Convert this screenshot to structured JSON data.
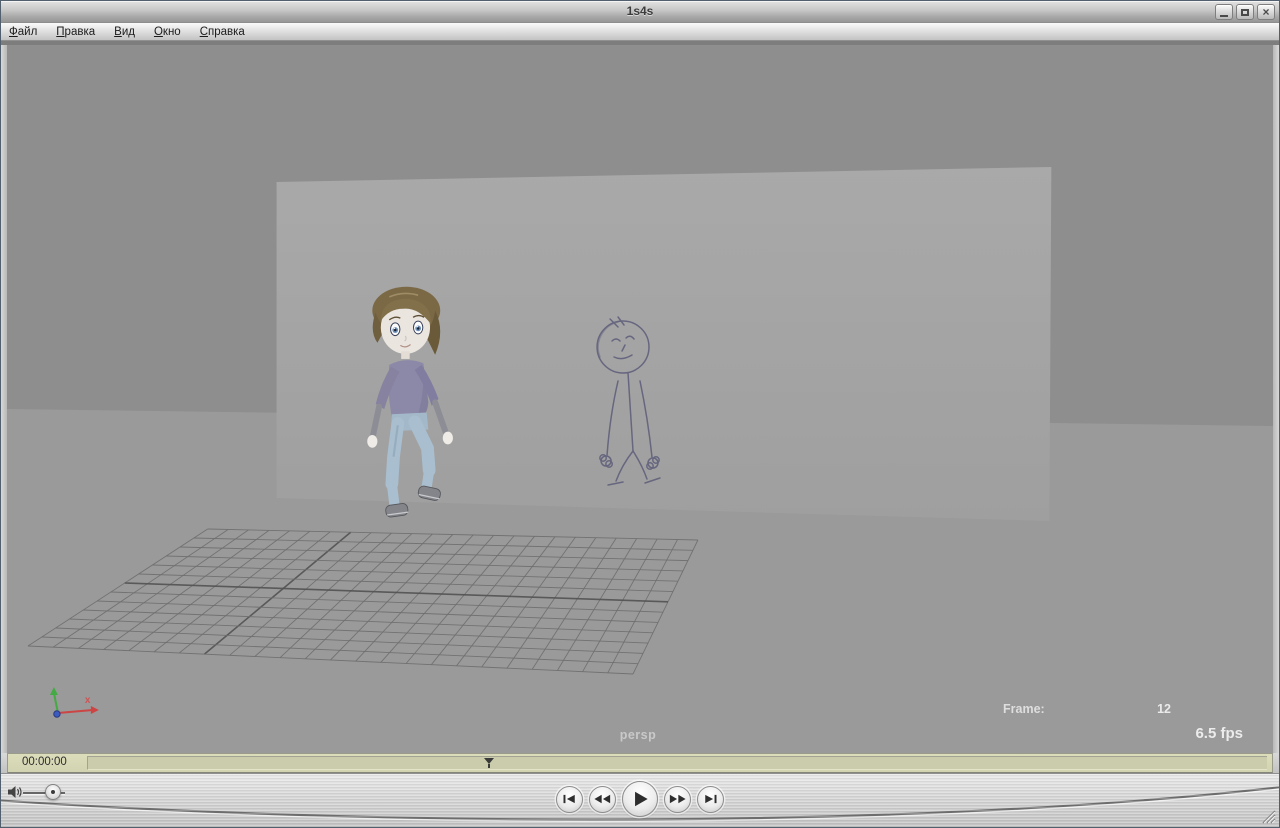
{
  "window": {
    "title": "1s4s",
    "controls": {
      "minimize": "minimize",
      "maximize": "maximize",
      "close": "close"
    }
  },
  "menu": {
    "items": [
      {
        "label": "Файл"
      },
      {
        "label": "Правка"
      },
      {
        "label": "Вид"
      },
      {
        "label": "Окно"
      },
      {
        "label": "Справка"
      }
    ]
  },
  "viewport": {
    "camera_label": "persp",
    "frame_label": "Frame:",
    "frame_value": "12",
    "fps_label": "6.5 fps",
    "axis_x_label": "x"
  },
  "transport": {
    "timecode": "00:00:00",
    "playhead_pct": 34,
    "volume_pct": 72,
    "buttons": [
      "jump-to-start",
      "rewind",
      "play",
      "fast-forward",
      "jump-to-end"
    ]
  },
  "colors": {
    "lcd_background": "#d7d8b5",
    "scene_sky": "#8e8e8e",
    "scene_ground": "#9a9a9a",
    "scene_wall": "#a6a6a6",
    "character_shirt": "#8c88a8",
    "character_jeans": "#a9bfcf",
    "character_hair": "#7b6946",
    "sketch_ink": "#5c5c7a",
    "axis_x": "#cc4444",
    "axis_y": "#44aa44",
    "axis_z": "#3a5bc0"
  }
}
